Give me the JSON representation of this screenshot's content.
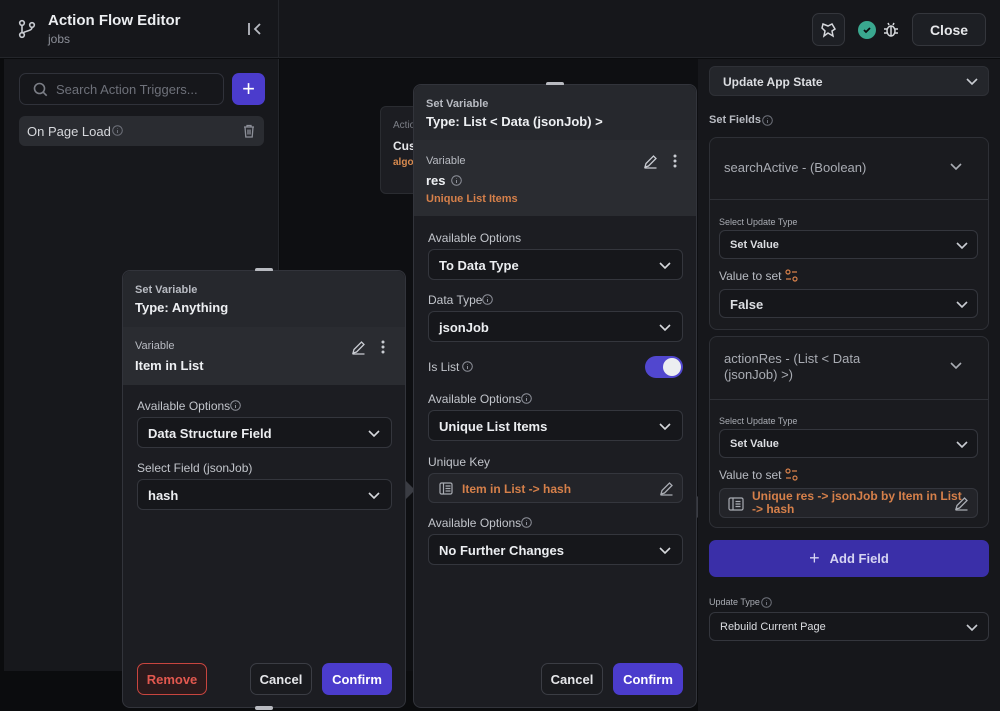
{
  "header": {
    "title": "Action Flow Editor",
    "subtitle": "jobs",
    "close_label": "Close"
  },
  "sidebar": {
    "search_placeholder": "Search Action Triggers...",
    "add_label": "+",
    "trigger_label": "On Page Load"
  },
  "canvas": {
    "bg_node_label1": "Actio",
    "bg_node_label2": "Cus",
    "bg_node_label3": "algo"
  },
  "panel_left": {
    "header_label": "Set Variable",
    "header_type": "Type: Anything",
    "variable_label": "Variable",
    "variable_name": "Item in List",
    "available_options_label": "Available Options",
    "available_options_value": "Data Structure Field",
    "select_field_label": "Select Field (jsonJob)",
    "select_field_value": "hash",
    "remove_label": "Remove",
    "cancel_label": "Cancel",
    "confirm_label": "Confirm"
  },
  "panel_mid": {
    "header_label": "Set Variable",
    "header_type": "Type: List < Data (jsonJob) >",
    "variable_label": "Variable",
    "variable_name": "res",
    "variable_sub": "Unique List Items",
    "opt1_label": "Available Options",
    "opt1_value": "To Data Type",
    "data_type_label": "Data Type",
    "data_type_value": "jsonJob",
    "is_list_label": "Is List",
    "opt2_label": "Available Options",
    "opt2_value": "Unique List Items",
    "unique_key_label": "Unique Key",
    "unique_key_value": "Item in List -> hash",
    "opt3_label": "Available Options",
    "opt3_value": "No Further Changes",
    "cancel_label": "Cancel",
    "confirm_label": "Confirm",
    "is_list_on": true
  },
  "right": {
    "action_type": "Update App State",
    "set_fields_label": "Set Fields",
    "field1_name": "searchActive - (Boolean)",
    "field1_update_type_label": "Select Update Type",
    "field1_update_type_value": "Set Value",
    "field1_value_label": "Value to set",
    "field1_value": "False",
    "field2_name_line1": "actionRes - (List < Data",
    "field2_name_line2": "(jsonJob) >)",
    "field2_update_type_label": "Select Update Type",
    "field2_update_type_value": "Set Value",
    "field2_value_label": "Value to set",
    "field2_value_line1": "Unique res -> jsonJob by Item in List",
    "field2_value_line2": "-> hash",
    "add_field_label": "Add Field",
    "update_type_label": "Update Type",
    "update_type_value": "Rebuild Current Page"
  },
  "colors": {
    "accent": "#4b3ccc",
    "orange": "#d6804a",
    "danger": "#e2584f",
    "success": "#3aa88f"
  }
}
